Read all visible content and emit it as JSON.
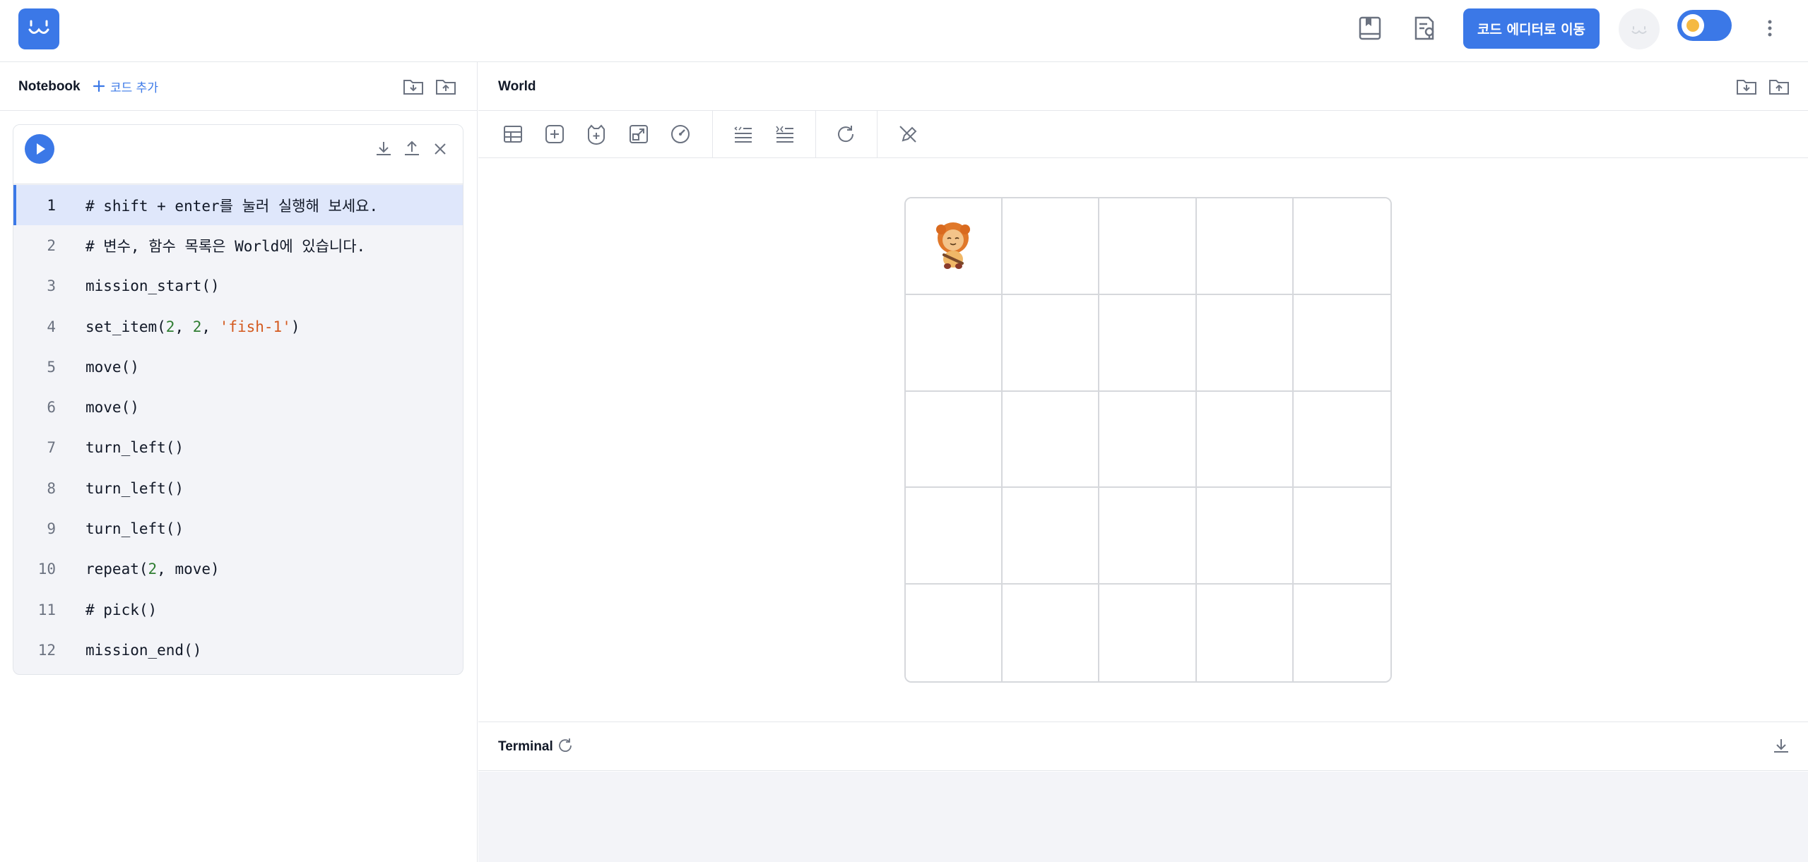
{
  "topbar": {
    "primary_button": "코드 에디터로 이동",
    "icons": [
      "book-icon",
      "document-search-icon",
      "avatar",
      "theme-toggle",
      "more-vertical-icon"
    ],
    "accent_color": "#3b78e7"
  },
  "notebook": {
    "title": "Notebook",
    "add_code_label": "코드 추가",
    "cell": {
      "lines": [
        {
          "no": "1",
          "active": true
        },
        {
          "no": "2"
        },
        {
          "no": "3"
        },
        {
          "no": "4"
        },
        {
          "no": "5"
        },
        {
          "no": "6"
        },
        {
          "no": "7"
        },
        {
          "no": "8"
        },
        {
          "no": "9"
        },
        {
          "no": "10"
        },
        {
          "no": "11"
        },
        {
          "no": "12"
        }
      ],
      "code": [
        "# shift + enter를 눌러 실행해 보세요.",
        "# 변수, 함수 목록은 World에 있습니다.",
        "mission_start()",
        "set_item(2, 2, 'fish-1')",
        "move()",
        "move()",
        "turn_left()",
        "turn_left()",
        "turn_left()",
        "repeat(2, move)",
        "# pick()",
        "mission_end()"
      ]
    }
  },
  "world": {
    "title": "World",
    "grid_rows": 5,
    "grid_cols": 5,
    "character_cell": [
      0,
      0
    ]
  },
  "terminal": {
    "title": "Terminal"
  }
}
